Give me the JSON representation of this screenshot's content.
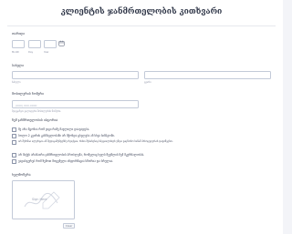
{
  "form": {
    "title": "კლიენტის ჯანმრთელობის კითხვარი"
  },
  "date": {
    "label": "თარიღი",
    "month_sub": "Month",
    "day_sub": "Day",
    "year_sub": "Year"
  },
  "name": {
    "label": "სახელი",
    "first_sub": "სახელი",
    "last_sub": "გვარი"
  },
  "phone": {
    "label": "მობილურის ნომერი",
    "placeholder": "(000) 000-0000",
    "hint": "შეიყვანეთ ვალიდური მობილურის ნომერი."
  },
  "conditions": {
    "label": "ჩემ ჯანმრთელობის ისტორია",
    "items": [
      "მე არა მგონია რომ ვიცი რამე ჩავლილი დაავადება.",
      "ბოლო 2 კვირის განმავლობაში არ მქონდა ცხელება ან სხვა სიმპტომი.",
      "არ მქონია ალერგია ან მედიკამენტებზე რეაქცია, რისი შესახებაც სპეციალისტს უნდა ვაცნობო სანამ პროცედურას დავიწყებთ.",
      "არ მაქვს არანაირი ჯანმრთელობის პრობლემა, რომელიც ხელს შეუშლის ჩემ მკურნალობას.",
      "ვადასტურებ რომ ზემოთ მოცემული ინფორმაცია სწორია და სრულია."
    ]
  },
  "signature": {
    "label": "ხელმოწერა",
    "placeholder": "Sign Here",
    "clear_label": "Clear"
  }
}
